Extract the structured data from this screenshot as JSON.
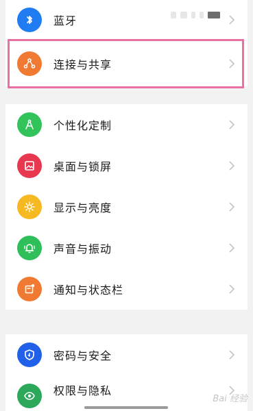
{
  "settings": {
    "items": [
      {
        "label": "蓝牙",
        "icon": "bluetooth-icon",
        "color": "#1f7cf2"
      },
      {
        "label": "连接与共享",
        "icon": "connection-share-icon",
        "color": "#f07a32"
      },
      {
        "label": "个性化定制",
        "icon": "personalization-icon",
        "color": "#32c35b"
      },
      {
        "label": "桌面与锁屏",
        "icon": "desktop-lockscreen-icon",
        "color": "#e8384f"
      },
      {
        "label": "显示与亮度",
        "icon": "display-brightness-icon",
        "color": "#f7b921"
      },
      {
        "label": "声音与振动",
        "icon": "sound-vibration-icon",
        "color": "#2fbf5a"
      },
      {
        "label": "通知与状态栏",
        "icon": "notification-statusbar-icon",
        "color": "#f07a32"
      },
      {
        "label": "密码与安全",
        "icon": "password-security-icon",
        "color": "#2160e8"
      },
      {
        "label": "权限与隐私",
        "icon": "permission-privacy-icon",
        "color": "#2ba85a"
      }
    ]
  },
  "highlight_color": "#ea6fa3",
  "watermark": "Bai 经验"
}
